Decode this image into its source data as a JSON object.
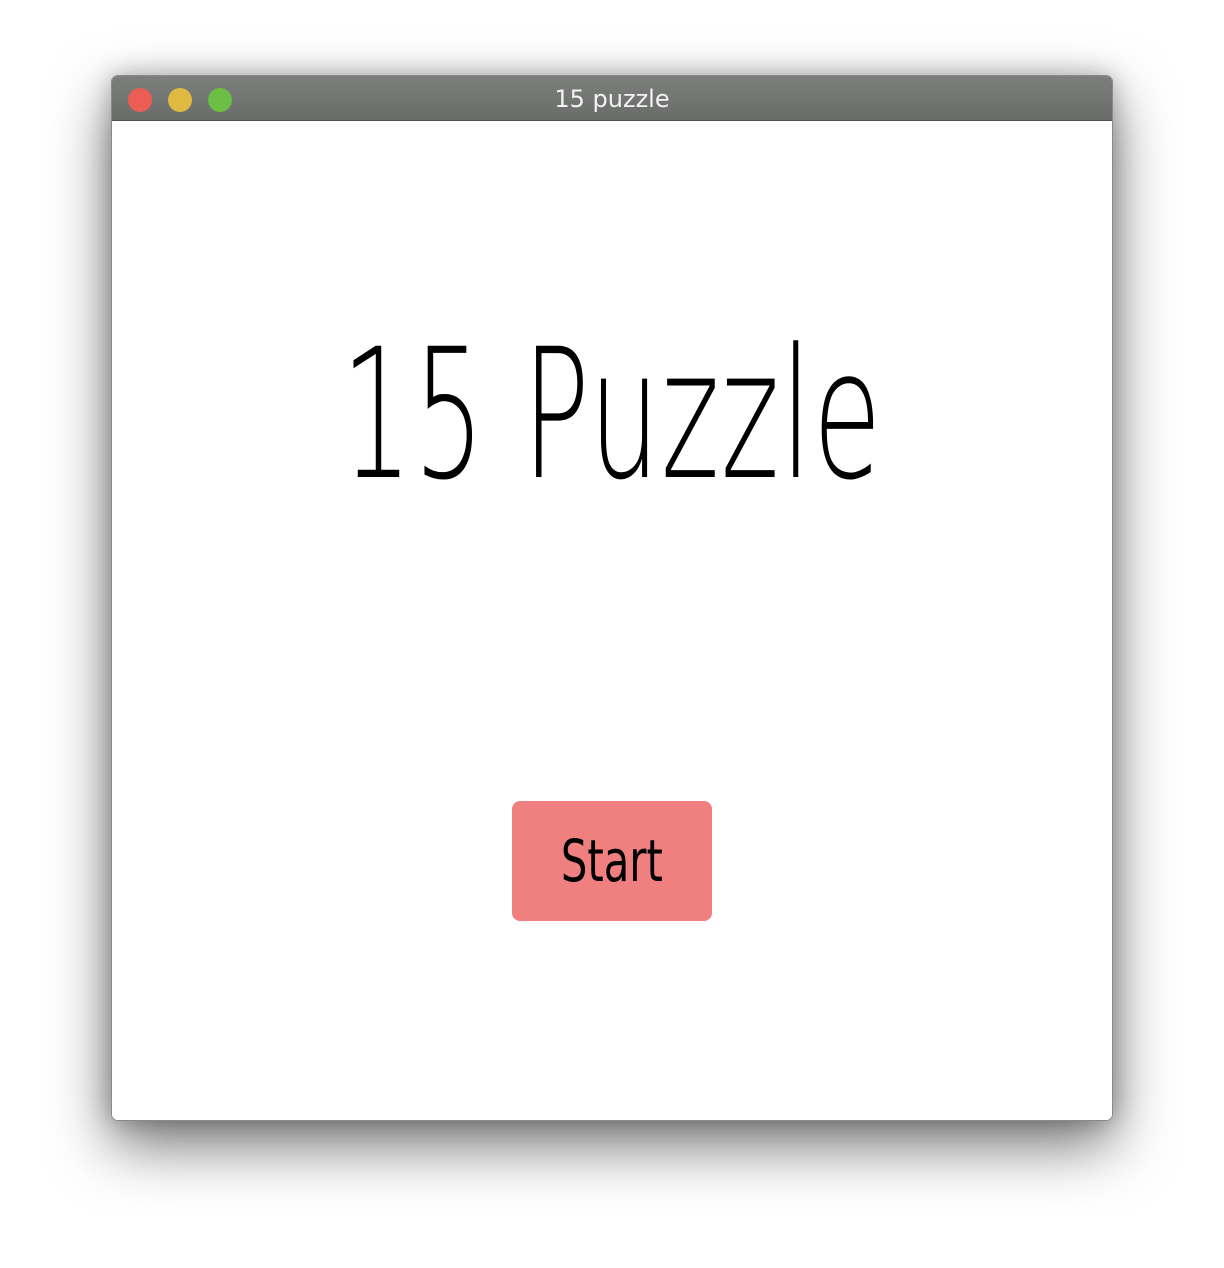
{
  "window": {
    "title": "15 puzzle",
    "controls": {
      "close_color": "#ec5e55",
      "minimize_color": "#e0b941",
      "zoom_color": "#6cbe45"
    }
  },
  "main": {
    "heading": "15 Puzzle",
    "start_button": {
      "label": "Start",
      "color": "#f08080"
    }
  }
}
